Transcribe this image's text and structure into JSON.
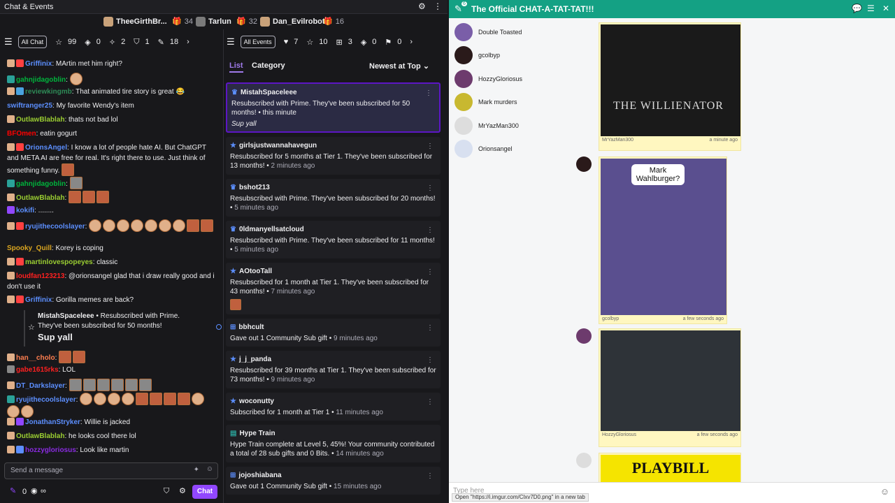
{
  "left_header": {
    "title": "Chat & Events"
  },
  "leaders": [
    {
      "name": "TheeGirthBr...",
      "count": ""
    },
    {
      "name": "",
      "count": "34"
    },
    {
      "name": "Tarlun",
      "count": ""
    },
    {
      "name": "",
      "count": "32"
    },
    {
      "name": "Dan_Evilrobot",
      "count": ""
    },
    {
      "name": "",
      "count": "16"
    }
  ],
  "chat_toolbar": {
    "all_chat": "All Chat",
    "stat1": "99",
    "stat2": "0",
    "stat3": "2",
    "stat4": "1",
    "stat5": "18"
  },
  "events_toolbar": {
    "all_events": "All Events",
    "stat1": "7",
    "stat2": "10",
    "stat3": "3",
    "stat4": "0",
    "stat5": "0"
  },
  "chat": [
    {
      "user": "Griffinix",
      "color": "#5c8fff",
      "text": ": MArtin met him right?"
    },
    {
      "user": "gahnjidagoblin",
      "color": "#00b33c",
      "text": ":"
    },
    {
      "user": "reviewkingmb",
      "color": "#2e8b57",
      "text": ": That animated tire story is great 😂"
    },
    {
      "user": "swiftranger25",
      "color": "#5c8fff",
      "text": ": My favorite Wendy's item"
    },
    {
      "user": "OutlawBlablah",
      "color": "#9acd32",
      "text": ": thats not bad lol"
    },
    {
      "user": "BFOmen",
      "color": "#ff0000",
      "text": ": eatin gogurt"
    },
    {
      "user": "OrionsAngel",
      "color": "#5c8fff",
      "text": ": I know a lot of people hate AI. But ChatGPT and META AI are free for real. It's right there to use. Just think of something funny."
    },
    {
      "user": "gahnjidagoblin",
      "color": "#00b33c",
      "text": ":"
    },
    {
      "user": "OutlawBlablah",
      "color": "#9acd32",
      "text": ":"
    },
    {
      "user": "kokifi",
      "color": "#5c8fff",
      "text": ": ........"
    },
    {
      "user": "ryujithecoolslayer",
      "color": "#5c8fff",
      "text": ":"
    },
    {
      "user": "Spooky_Quill",
      "color": "#daa520",
      "text": ": Korey is coping"
    },
    {
      "user": "martinlovespopeyes",
      "color": "#9acd32",
      "text": ": classic"
    },
    {
      "user": "loudfan123213",
      "color": "#ff2020",
      "text": ": @orionsangel glad that i draw really good and i don't use it"
    },
    {
      "user": "Griffinix",
      "color": "#5c8fff",
      "text": ": Gorilla memes are back?"
    },
    {
      "user": "han__cholo",
      "color": "#ff7f50",
      "text": ":"
    },
    {
      "user": "gabe1615rks",
      "color": "#ff2020",
      "text": ": LOL"
    },
    {
      "user": "DT_Darkslayer",
      "color": "#5c8fff",
      "text": ":"
    },
    {
      "user": "ryujithecoolslayer",
      "color": "#5c8fff",
      "text": ":"
    },
    {
      "user": "JonathanStryker",
      "color": "#5c8fff",
      "text": ": Willie is jacked"
    },
    {
      "user": "OutlawBlablah",
      "color": "#9acd32",
      "text": ": he looks cool there lol"
    },
    {
      "user": "hozzygloriosus",
      "color": "#8a2be2",
      "text": ": Look like martin"
    }
  ],
  "pinned": {
    "user": "MistahSpaceleee",
    "line1": " • Resubscribed with Prime.",
    "line2": "They've been subscribed for 50 months!",
    "message": "Sup yall"
  },
  "chat_input": {
    "placeholder": "Send a message",
    "points": "0",
    "chat_button": "Chat",
    "infinity": "∞"
  },
  "events_tabs": {
    "list": "List",
    "category": "Category",
    "sort": "Newest at Top"
  },
  "events": [
    {
      "name": "MistahSpaceleee",
      "desc": "Resubscribed with Prime. They've been subscribed for 50 months!",
      "ago": "this minute",
      "note": "Sup yall"
    },
    {
      "name": "girlsjustwannahavegun",
      "desc": "Resubscribed for 5 months at Tier 1. They've been subscribed for 13 months!",
      "ago": "2 minutes ago",
      "note": ""
    },
    {
      "name": "bshot213",
      "desc": "Resubscribed with Prime. They've been subscribed for 20 months!",
      "ago": "5 minutes ago",
      "note": ""
    },
    {
      "name": "0ldmanyellsatcloud",
      "desc": "Resubscribed with Prime. They've been subscribed for 11 months!",
      "ago": "5 minutes ago",
      "note": ""
    },
    {
      "name": "AOtooTall",
      "desc": "Resubscribed for 1 month at Tier 1. They've been subscribed for 43 months!",
      "ago": "7 minutes ago",
      "note": ""
    },
    {
      "name": "bbhcult",
      "desc": "Gave out 1 Community Sub gift",
      "ago": "9 minutes ago",
      "note": ""
    },
    {
      "name": "j_j_panda",
      "desc": "Resubscribed for 39 months at Tier 1. They've been subscribed for 73 months!",
      "ago": "9 minutes ago",
      "note": ""
    },
    {
      "name": "woconutty",
      "desc": "Subscribed for 1 month at Tier 1",
      "ago": "11 minutes ago",
      "note": ""
    },
    {
      "name": "Hype Train",
      "desc": "Hype Train complete at Level 5, 45%! Your community contributed a total of 28 sub gifts and 0 Bits.",
      "ago": "14 minutes ago",
      "note": ""
    },
    {
      "name": "jojoshiabana",
      "desc": "Gave out 1 Community Sub gift",
      "ago": "15 minutes ago",
      "note": ""
    }
  ],
  "right_header": {
    "title": "The Official CHAT-A-TAT-TAT!!!",
    "badge": "6"
  },
  "users": [
    "Double Toasted",
    "gcolbyp",
    "HozzyGloriosus",
    "Mark murders",
    "MrYazMan300",
    "Orionsangel"
  ],
  "posts": [
    {
      "user": "MrYazMan300",
      "time": "a minute ago",
      "caption": "THE WILLIENATOR"
    },
    {
      "user": "gcolbyp",
      "time": "a few seconds ago",
      "caption": "Mark Wahlburger?"
    },
    {
      "user": "HozzyGloriosus",
      "time": "a few seconds ago",
      "caption": ""
    },
    {
      "user": "",
      "time": "",
      "caption": "PLAYBILL"
    }
  ],
  "right_footer": {
    "placeholder": "Type here"
  },
  "status_bar": "Open \"https://i.imgur.com/Clxv7D0.png\" in a new tab",
  "colors": {
    "accent": "#9147ff",
    "teal": "#14a184"
  }
}
